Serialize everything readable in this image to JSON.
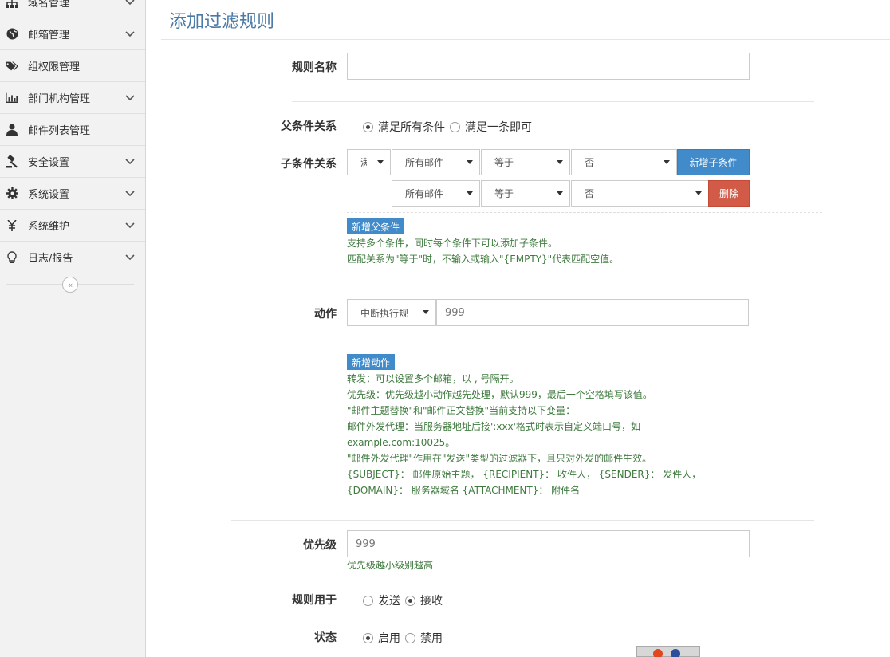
{
  "sidebar": {
    "items": [
      {
        "label": "域名管理",
        "icon": "sitemap-icon",
        "has_children": true
      },
      {
        "label": "邮箱管理",
        "icon": "globe-icon",
        "has_children": true
      },
      {
        "label": "组权限管理",
        "icon": "tags-icon",
        "has_children": false
      },
      {
        "label": "部门机构管理",
        "icon": "bar-chart-icon",
        "has_children": true
      },
      {
        "label": "邮件列表管理",
        "icon": "user-icon",
        "has_children": false
      },
      {
        "label": "安全设置",
        "icon": "gavel-icon",
        "has_children": true
      },
      {
        "label": "系统设置",
        "icon": "gear-icon",
        "has_children": true
      },
      {
        "label": "系统维护",
        "icon": "yen-icon",
        "has_children": true
      },
      {
        "label": "日志/报告",
        "icon": "lightbulb-icon",
        "has_children": true
      }
    ],
    "collapse_glyph": "«"
  },
  "page": {
    "title": "添加过滤规则"
  },
  "form": {
    "rule_name": {
      "label": "规则名称",
      "value": ""
    },
    "parent_relation": {
      "label": "父条件关系",
      "options": [
        {
          "text": "满足所有条件",
          "checked": true
        },
        {
          "text": "满足一条即可",
          "checked": false
        }
      ]
    },
    "child_relation": {
      "label": "子条件关系",
      "row1": {
        "logic": "满",
        "field": "所有邮件",
        "operator": "等于",
        "value": "否",
        "add_button": "新增子条件"
      },
      "row2": {
        "field": "所有邮件",
        "operator": "等于",
        "value": "否",
        "delete_button": "删除"
      },
      "add_parent_button": "新增父条件",
      "help": [
        "支持多个条件，同时每个条件下可以添加子条件。",
        "匹配关系为\"等于\"时，不输入或输入\"{EMPTY}\"代表匹配空值。"
      ]
    },
    "action": {
      "label": "动作",
      "select": "中断执行规",
      "value": "999",
      "add_button": "新增动作",
      "help": [
        "转发：可以设置多个邮箱，以 , 号隔开。",
        "优先级：优先级越小动作越先处理，默认999，最后一个空格填写该值。",
        "\"邮件主题替换\"和\"邮件正文替换\"当前支持以下变量：",
        "邮件外发代理：当服务器地址后接':xxx'格式时表示自定义端口号，如",
        "example.com:10025。",
        "\"邮件外发代理\"作用在\"发送\"类型的过滤器下，且只对外发的邮件生效。",
        "{SUBJECT}： 邮件原始主题， {RECIPIENT}： 收件人， {SENDER}： 发件人，",
        "{DOMAIN}： 服务器域名 {ATTACHMENT}： 附件名"
      ]
    },
    "priority": {
      "label": "优先级",
      "value": "999",
      "help": "优先级越小级别越高"
    },
    "apply_to": {
      "label": "规则用于",
      "options": [
        {
          "text": "发送",
          "checked": false
        },
        {
          "text": "接收",
          "checked": true
        }
      ]
    },
    "status": {
      "label": "状态",
      "options": [
        {
          "text": "启用",
          "checked": true
        },
        {
          "text": "禁用",
          "checked": false
        }
      ]
    }
  },
  "colors": {
    "accent": "#428bca",
    "danger": "#d15b47",
    "title": "#4a7aa6",
    "help_text": "#3f7a3f"
  }
}
